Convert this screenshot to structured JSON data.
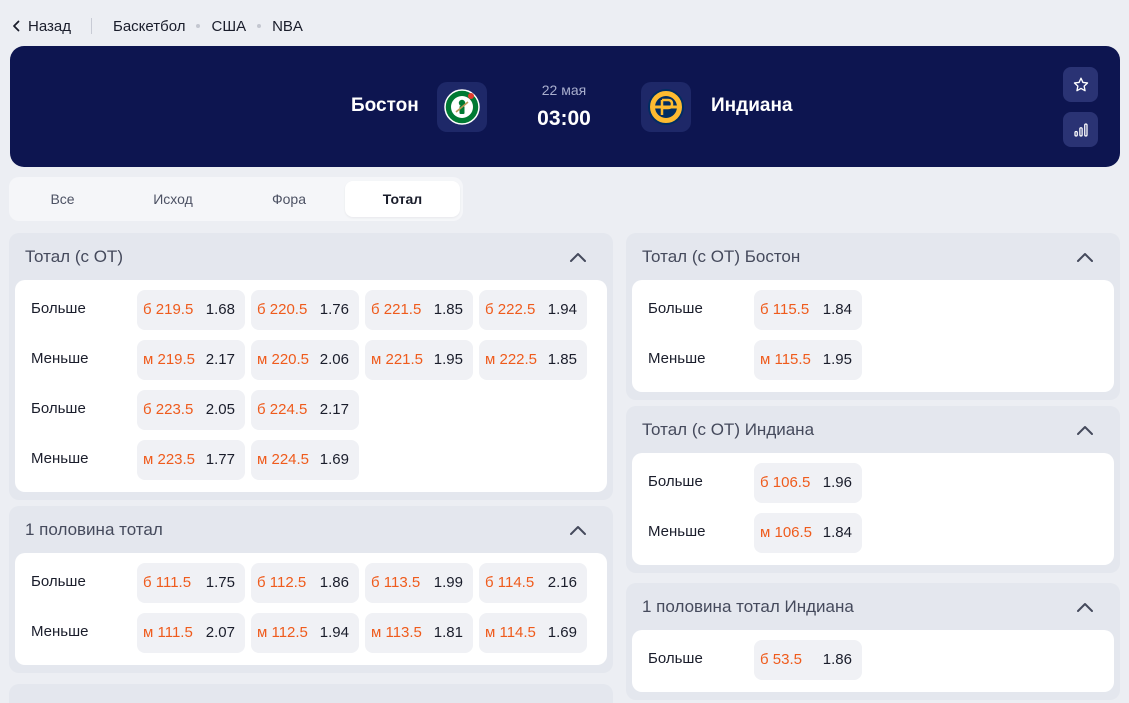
{
  "nav": {
    "back_label": "Назад",
    "breadcrumbs": [
      "Баскетбол",
      "США",
      "NBA"
    ]
  },
  "event": {
    "home": "Бостон",
    "away": "Индиана",
    "date": "22 мая",
    "time": "03:00",
    "home_logo": "celtics-logo",
    "away_logo": "pacers-logo"
  },
  "header_buttons": [
    "star-icon",
    "stats-icon"
  ],
  "tabs": [
    "Все",
    "Исход",
    "Фора",
    "Тотал"
  ],
  "active_tab": "Тотал",
  "colors": {
    "header_bg": "#0d1550",
    "accent_orange": "#ef5b1c",
    "page_bg": "#eceef3",
    "odd_bg": "#f0f1f5"
  },
  "markets_left": [
    {
      "title": "Тотал (с ОТ)",
      "rows": [
        {
          "label": "Больше",
          "odds": [
            [
              "б 219.5",
              "1.68"
            ],
            [
              "б 220.5",
              "1.76"
            ],
            [
              "б 221.5",
              "1.85"
            ],
            [
              "б 222.5",
              "1.94"
            ]
          ]
        },
        {
          "label": "Меньше",
          "odds": [
            [
              "м 219.5",
              "2.17"
            ],
            [
              "м 220.5",
              "2.06"
            ],
            [
              "м 221.5",
              "1.95"
            ],
            [
              "м 222.5",
              "1.85"
            ]
          ]
        },
        {
          "label": "Больше",
          "odds": [
            [
              "б 223.5",
              "2.05"
            ],
            [
              "б 224.5",
              "2.17"
            ]
          ]
        },
        {
          "label": "Меньше",
          "odds": [
            [
              "м 223.5",
              "1.77"
            ],
            [
              "м 224.5",
              "1.69"
            ]
          ]
        }
      ]
    },
    {
      "title": "1 половина тотал",
      "rows": [
        {
          "label": "Больше",
          "odds": [
            [
              "б 111.5",
              "1.75"
            ],
            [
              "б 112.5",
              "1.86"
            ],
            [
              "б 113.5",
              "1.99"
            ],
            [
              "б 114.5",
              "2.16"
            ]
          ]
        },
        {
          "label": "Меньше",
          "odds": [
            [
              "м 111.5",
              "2.07"
            ],
            [
              "м 112.5",
              "1.94"
            ],
            [
              "м 113.5",
              "1.81"
            ],
            [
              "м 114.5",
              "1.69"
            ]
          ]
        }
      ]
    }
  ],
  "markets_right": [
    {
      "title": "Тотал (с ОТ) Бостон",
      "rows": [
        {
          "label": "Больше",
          "odds": [
            [
              "б 115.5",
              "1.84"
            ]
          ]
        },
        {
          "label": "Меньше",
          "odds": [
            [
              "м 115.5",
              "1.95"
            ]
          ]
        }
      ]
    },
    {
      "title": "Тотал (с ОТ) Индиана",
      "rows": [
        {
          "label": "Больше",
          "odds": [
            [
              "б 106.5",
              "1.96"
            ]
          ]
        },
        {
          "label": "Меньше",
          "odds": [
            [
              "м 106.5",
              "1.84"
            ]
          ]
        }
      ]
    },
    {
      "title": "1 половина тотал Индиана",
      "rows": [
        {
          "label": "Больше",
          "odds": [
            [
              "б 53.5",
              "1.86"
            ]
          ]
        }
      ]
    }
  ]
}
